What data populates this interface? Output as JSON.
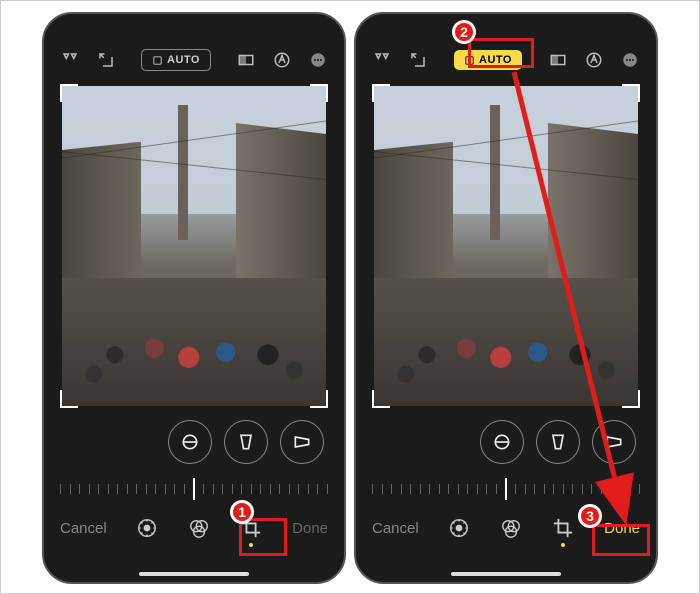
{
  "topbar": {
    "auto_label": "AUTO"
  },
  "bottom": {
    "cancel_label": "Cancel",
    "done_label": "Done"
  },
  "annotations": {
    "step1": "1",
    "step2": "2",
    "step3": "3"
  },
  "colors": {
    "highlight": "#e21b1b",
    "accent": "#f7d94c"
  }
}
